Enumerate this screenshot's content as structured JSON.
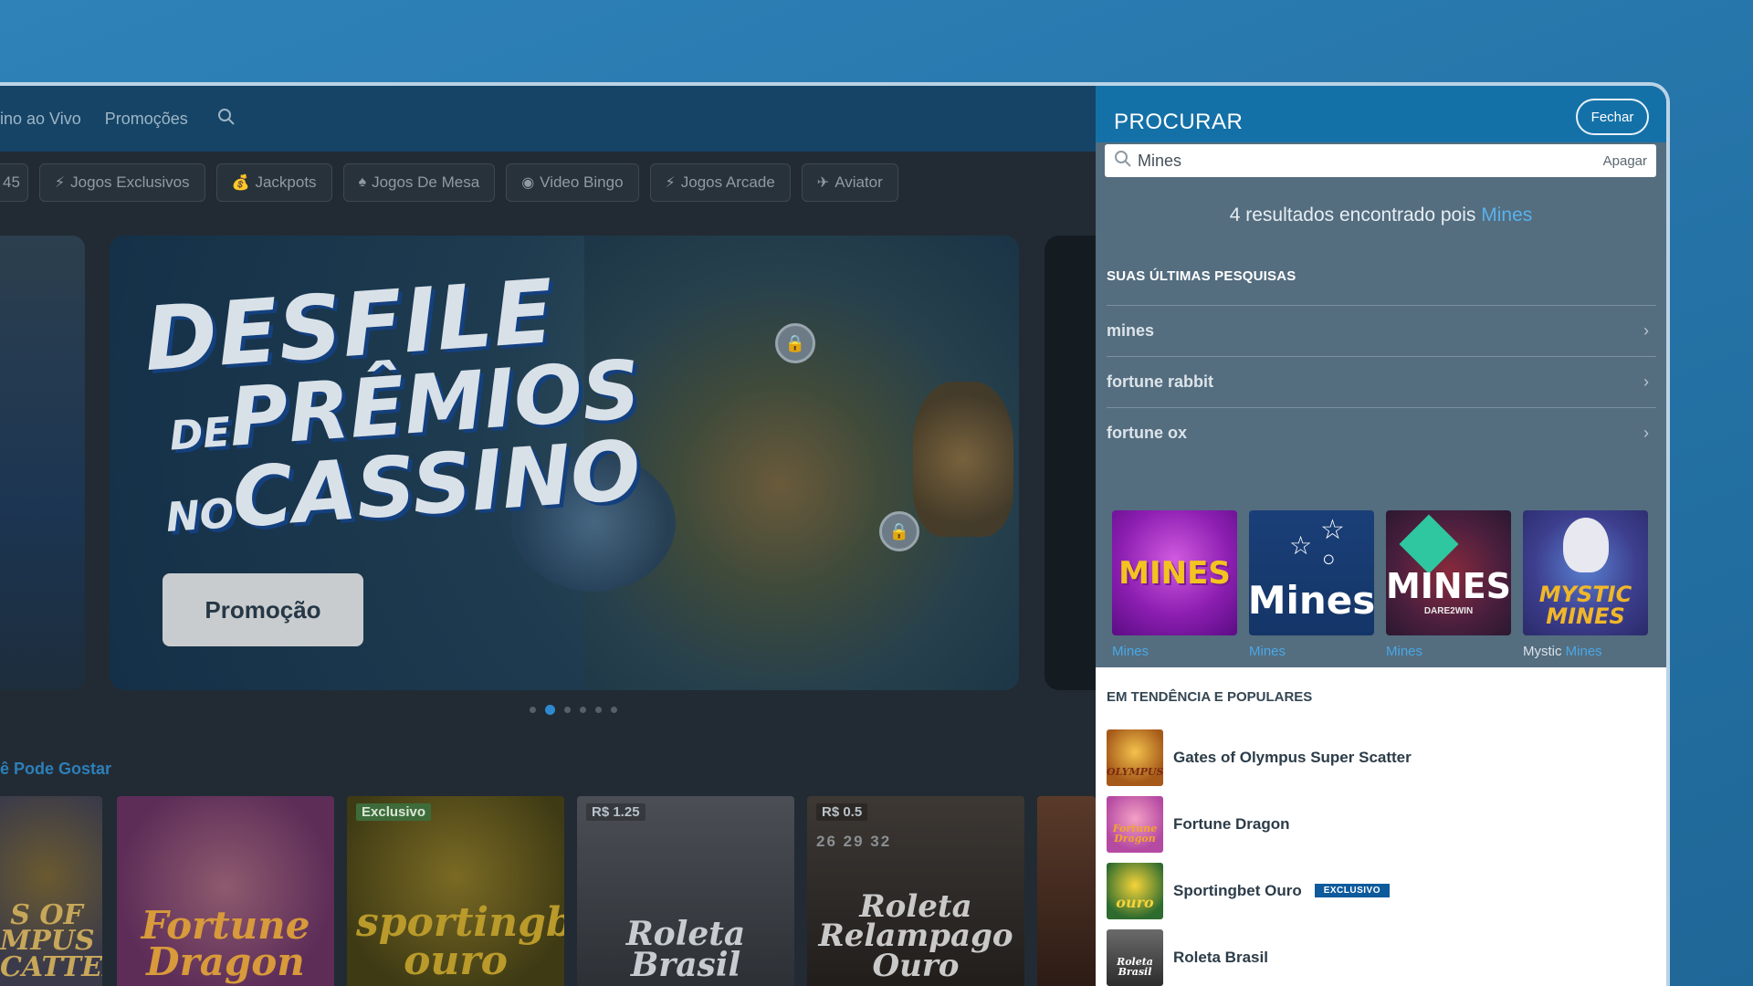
{
  "site": {
    "nav": {
      "items": [
        "ino ao Vivo",
        "Promoções"
      ],
      "search_icon": "search-icon"
    },
    "categories": [
      {
        "label": "45",
        "icon": ""
      },
      {
        "label": "Jogos Exclusivos",
        "icon": "bolt-icon"
      },
      {
        "label": "Jackpots",
        "icon": "moneybag-icon"
      },
      {
        "label": "Jogos De Mesa",
        "icon": "cards-icon"
      },
      {
        "label": "Video Bingo",
        "icon": "bingo-ball-icon"
      },
      {
        "label": "Jogos Arcade",
        "icon": "bolt-icon"
      },
      {
        "label": "Aviator",
        "icon": "plane-icon"
      }
    ],
    "banner": {
      "title_line1": "DESFILE",
      "title_line2_small": "DE",
      "title_line2": "PRÊMIOS",
      "title_line3_small": "NO",
      "title_line3": "CASSINO",
      "button": "Promoção"
    },
    "carousel": {
      "count": 6,
      "active": 1
    },
    "section_title": "ê Pode Gostar",
    "games": [
      {
        "title": "S OF\nMPUS\nCATTER",
        "tag": "",
        "price": ""
      },
      {
        "title": "Fortune\nDragon",
        "tag": "",
        "price": ""
      },
      {
        "title": "sportingbet\nouro",
        "tag": "Exclusivo",
        "price": ""
      },
      {
        "title": "Roleta\nBrasil",
        "tag": "",
        "price": "R$ 1.25"
      },
      {
        "title": "Roleta\nRelampago\nOuro",
        "tag": "",
        "price": "R$ 0.5",
        "numbers": "26  29  32"
      }
    ]
  },
  "panel": {
    "title": "PROCURAR",
    "close_label": "Fechar",
    "search": {
      "value": "Mines",
      "clear_label": "Apagar"
    },
    "results": {
      "prefix": "4 resultados encontrado pois ",
      "term": "Mines"
    },
    "recent_title": "SUAS ÚLTIMAS PESQUISAS",
    "recent": [
      "mines",
      "fortune rabbit",
      "fortune ox"
    ],
    "tiles": [
      {
        "art": "MINES",
        "cap_prefix": "",
        "cap_hl": "Mines"
      },
      {
        "art": "Mines",
        "cap_prefix": "",
        "cap_hl": "Mines"
      },
      {
        "art": "MINES",
        "art_sub": "DARE2WIN",
        "cap_prefix": "",
        "cap_hl": "Mines"
      },
      {
        "art": "MYSTIC MINES",
        "cap_prefix": "Mystic ",
        "cap_hl": "Mines"
      }
    ],
    "trend_title": "EM TENDÊNCIA E POPULARES",
    "trend": [
      {
        "name": "Gates of Olympus Super Scatter",
        "thumb": "OLYMPUS",
        "badge": ""
      },
      {
        "name": "Fortune Dragon",
        "thumb": "Fortune Dragon",
        "badge": ""
      },
      {
        "name": "Sportingbet Ouro",
        "thumb": "ouro",
        "badge": "EXCLUSIVO"
      },
      {
        "name": "Roleta Brasil",
        "thumb": "Roleta Brasil",
        "badge": ""
      }
    ]
  },
  "colors": {
    "accent": "#1471a8",
    "highlight": "#4aa8e6",
    "badge": "#0d5a9c"
  }
}
